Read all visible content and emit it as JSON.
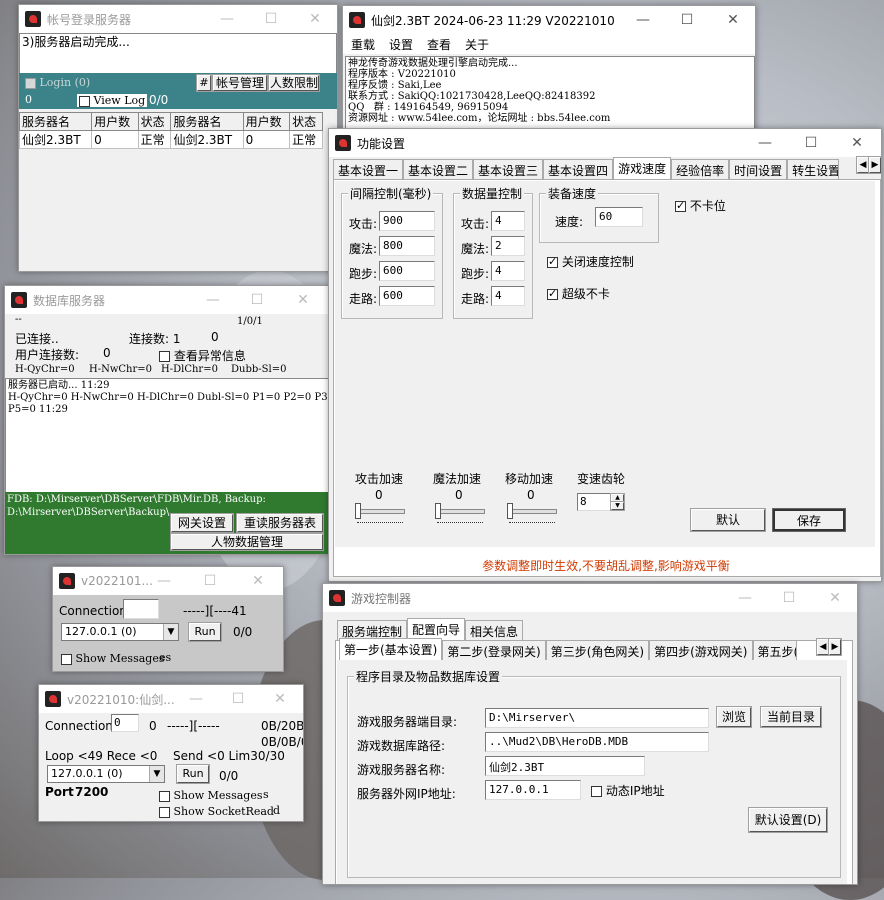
{
  "account_server": {
    "title": "帐号登录服务器",
    "log": "3)服务器启动完成...",
    "login_label": "Login (0)",
    "count_left": "0",
    "view_log": "View Log",
    "ratio": "0/0",
    "hash_btn": "#",
    "account_mgmt": "帐号管理",
    "user_limit": "人数限制",
    "columns": [
      "服务器名",
      "用户数",
      "状态",
      "服务器名",
      "用户数",
      "状态"
    ],
    "rows": [
      [
        "仙剑2.3BT",
        "0",
        "正常",
        "仙剑2.3BT",
        "0",
        "正常"
      ]
    ]
  },
  "main_window": {
    "title": "仙剑2.3BT 2024-06-23 11:29 V20221010",
    "menu": [
      "重载",
      "设置",
      "查看",
      "关于"
    ],
    "log": "神龙传奇游戏数据处理引擎启动完成...\n程序版本 : V20221010\n程序反馈 : Saki,Lee\n联系方式 : SakiQQ:1021730428,LeeQQ:82418392\nQQ   群 : 149164549, 96915094\n资源网址 : www.54lee.com，论坛网址 : bbs.54lee.com"
  },
  "db_server": {
    "title": "数据库服务器",
    "dash": "--",
    "pages": "1/0/1",
    "connected": "已连接..",
    "conn_count": "连接数: 1",
    "conn_zero": "0",
    "user_conn": "用户连接数:",
    "user_conn_val": "0",
    "show_error": "查看异常信息",
    "stats": [
      "H-QyChr=0",
      "H-NwChr=0",
      "H-DlChr=0",
      "Dubb-Sl=0"
    ],
    "log": "服务器已启动... 11:29\nH-QyChr=0 H-NwChr=0 H-DlChr=0 Dubl-Sl=0 P1=0 P2=0 P3=0 P4=0\nP5=0 11:29",
    "path1": "FDB: D:\\Mirserver\\DBServer\\FDB\\Mir.DB, Backup:",
    "path2": "D:\\Mirserver\\DBServer\\Backup\\",
    "gateway_btn": "网关设置",
    "reload_btn": "重读服务器表",
    "char_btn": "人物数据管理"
  },
  "gate1": {
    "title": "v2022101...",
    "connection": "Connection",
    "dashes": "-----][----41",
    "ip": "127.0.0.1  (0)",
    "run": "Run",
    "ratio": "0/0",
    "show_msg": "Show Messages",
    "cut": "es"
  },
  "gate2": {
    "title": "v20221010:仙剑...",
    "connection": "Connection",
    "conn_val": "0",
    "zero": "0",
    "dashes": "-----][-----",
    "b1": "0B/20B",
    "b2": "0B/0B/0",
    "loop": "Loop <49  Rece <0",
    "send": "Send <0 Lim30/30",
    "ip": "127.0.0.1  (0)",
    "run": "Run",
    "ratio": "0/0",
    "port_label": "Port",
    "port": "7200",
    "show_msg": "Show Messages",
    "show_sock": "Show SocketRead",
    "cut1": "s",
    "cut2": "d"
  },
  "func_settings": {
    "title": "功能设置",
    "tabs": [
      "基本设置一",
      "基本设置二",
      "基本设置三",
      "基本设置四",
      "游戏速度",
      "经验倍率",
      "时间设置",
      "转生设置"
    ],
    "active_tab": 4,
    "interval_group": "间隔控制(毫秒)",
    "interval": [
      {
        "label": "攻击:",
        "value": "900"
      },
      {
        "label": "魔法:",
        "value": "800"
      },
      {
        "label": "跑步:",
        "value": "600"
      },
      {
        "label": "走路:",
        "value": "600"
      }
    ],
    "amount_group": "数据量控制",
    "amount": [
      {
        "label": "攻击:",
        "value": "4"
      },
      {
        "label": "魔法:",
        "value": "2"
      },
      {
        "label": "跑步:",
        "value": "4"
      },
      {
        "label": "走路:",
        "value": "4"
      }
    ],
    "equip_group": "装备速度",
    "speed_label": "速度:",
    "speed_value": "60",
    "no_stuck": "不卡位",
    "close_speed": "关闭速度控制",
    "super_no_stuck": "超级不卡",
    "sliders": [
      {
        "label": "攻击加速",
        "value": "0"
      },
      {
        "label": "魔法加速",
        "value": "0"
      },
      {
        "label": "移动加速",
        "value": "0"
      }
    ],
    "gear_label": "变速齿轮",
    "gear_value": "8",
    "default_btn": "默认",
    "save_btn": "保存",
    "warning": "参数调整即时生效,不要胡乱调整,影响游戏平衡",
    "warning_color": "#d03a00"
  },
  "game_control": {
    "title": "游戏控制器",
    "top_tabs": [
      "服务端控制",
      "配置向导",
      "相关信息"
    ],
    "active_top": 1,
    "step_tabs": [
      "第一步(基本设置)",
      "第二步(登录网关)",
      "第三步(角色网关)",
      "第四步(游戏网关)",
      "第五步("
    ],
    "group_title": "程序目录及物品数据库设置",
    "fields": [
      {
        "label": "游戏服务器端目录:",
        "value": "D:\\Mirserver\\"
      },
      {
        "label": "游戏数据库路径:",
        "value": "..\\Mud2\\DB\\HeroDB.MDB"
      },
      {
        "label": "游戏服务器名称:",
        "value": "仙剑2.3BT"
      },
      {
        "label": "服务器外网IP地址:",
        "value": "127.0.0.1"
      }
    ],
    "browse_btn": "浏览",
    "current_dir_btn": "当前目录",
    "dynamic_ip": "动态IP地址",
    "default_settings_btn": "默认设置(D)"
  }
}
